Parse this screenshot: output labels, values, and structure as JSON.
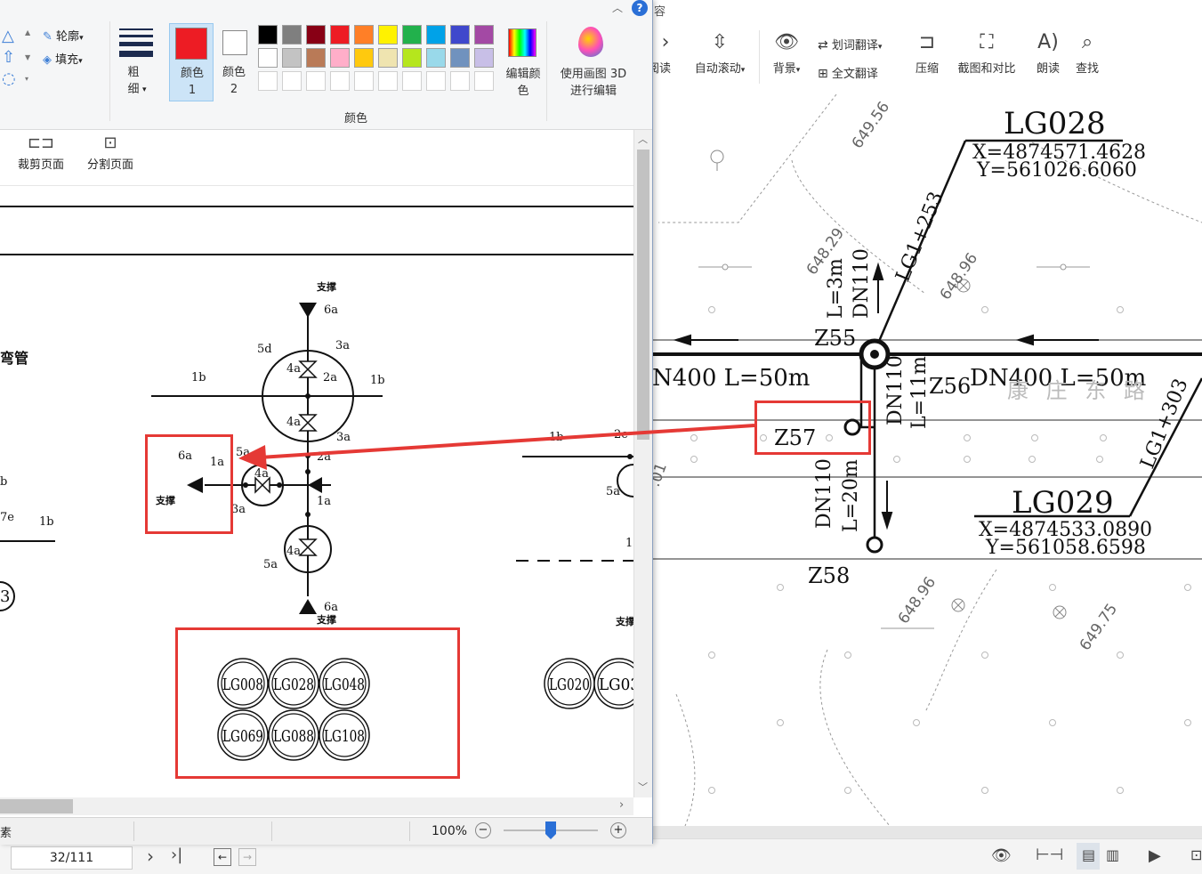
{
  "paint": {
    "ribbon": {
      "outline_label": "轮廓",
      "fill_label": "填充",
      "size_label": "粗细",
      "color1_label": "颜色 1",
      "color2_label": "颜色 2",
      "colors_group_label": "颜色",
      "edit_colors_label": "编辑颜色",
      "paint3d_label": "使用画图 3D 进行编辑",
      "color1_value": "#ed1c24",
      "color2_value": "#ffffff",
      "palette_row1": [
        "#000000",
        "#7f7f7f",
        "#880015",
        "#ed1c24",
        "#ff7f27",
        "#fff200",
        "#22b14c",
        "#00a2e8",
        "#3f48cc",
        "#a349a4"
      ],
      "palette_row2": [
        "#ffffff",
        "#c3c3c3",
        "#b97a57",
        "#ffaec9",
        "#ffc90e",
        "#efe4b0",
        "#b5e61d",
        "#99d9ea",
        "#7092be",
        "#c8bfe7"
      ]
    },
    "subribbon": {
      "crop_page": "裁剪页面",
      "split_page": "分割页面"
    },
    "drawing": {
      "side_text": "弯管",
      "support_top": "支撑",
      "support_bottom": "支撑",
      "support_left": "支撑",
      "support_right": "支撑",
      "lbl_6a_top": "6a",
      "lbl_5d": "5d",
      "lbl_3a_top": "3a",
      "lbl_4a_1": "4a",
      "lbl_2a": "2a",
      "lbl_1b_left": "1b",
      "lbl_1b_right": "1b",
      "lbl_4a_2": "4a",
      "lbl_3a_mid": "3a",
      "lbl_6a_left": "6a",
      "lbl_1a_left": "1a",
      "lbl_5a_mid": "5a",
      "lbl_2a_mid": "2a",
      "lbl_4a_mid": "4a",
      "lbl_3a_left": "3a",
      "lbl_1a_mid": "1a",
      "lbl_4a_low": "4a",
      "lbl_5a_low": "5a",
      "lbl_6a_bottom": "6a",
      "lbl_1b_far": "1b",
      "lbl_2c": "2c",
      "lbl_5a_far": "5a",
      "lbl_1_far": "1(",
      "lbl_b_edge": "b",
      "lbl_7e": "7e",
      "lbl_1b_edge": "1b",
      "lbl_3_edge": "3",
      "lg_circles": [
        "LG008",
        "LG028",
        "LG048",
        "LG069",
        "LG088",
        "LG108"
      ],
      "lg_far": [
        "LG020",
        "LG03"
      ]
    },
    "statusbar": {
      "left_text": "素",
      "zoom": "100%"
    }
  },
  "pdf": {
    "toolbar": {
      "read_label": "阅读",
      "auto_scroll": "自动滚动",
      "background": "背景",
      "word_translate": "划词翻译",
      "full_translate": "全文翻译",
      "compress": "压缩",
      "screenshot_compare": "截图和对比",
      "read_aloud": "朗读",
      "search": "查找",
      "top_cut": "容"
    },
    "drawing": {
      "lg028": "LG028",
      "lg028_x": "X=4874571.4628",
      "lg028_y": "Y=561026.6060",
      "lg029": "LG029",
      "lg029_x": "X=4874533.0890",
      "lg029_y": "Y=561058.6598",
      "elev_1": "649.56",
      "elev_2": "648.29",
      "elev_3": "648.96",
      "elev_4": "648.96",
      "elev_5": "649.75",
      "lg1_253": "LG1+253",
      "lg1_303": "LG1+303",
      "l3m": "L=3m",
      "dn110_top": "DN110",
      "z55": "Z55",
      "z56": "Z56",
      "z57": "Z57",
      "z58": "Z58",
      "dn400_left": "N400  L=50m",
      "dn400_right": "DN400  L=50m",
      "dn110_mid": "DN110",
      "l11m": "L=11m",
      "dn110_low": "DN110",
      "l20m": "L=20m",
      "road": "康 庄 东 路",
      "edge_01": ".01"
    },
    "statusbar": {
      "page": "32/111"
    }
  },
  "colors": {
    "annotation_red": "#e53935",
    "ribbon_bg": "#f5f6f7"
  }
}
